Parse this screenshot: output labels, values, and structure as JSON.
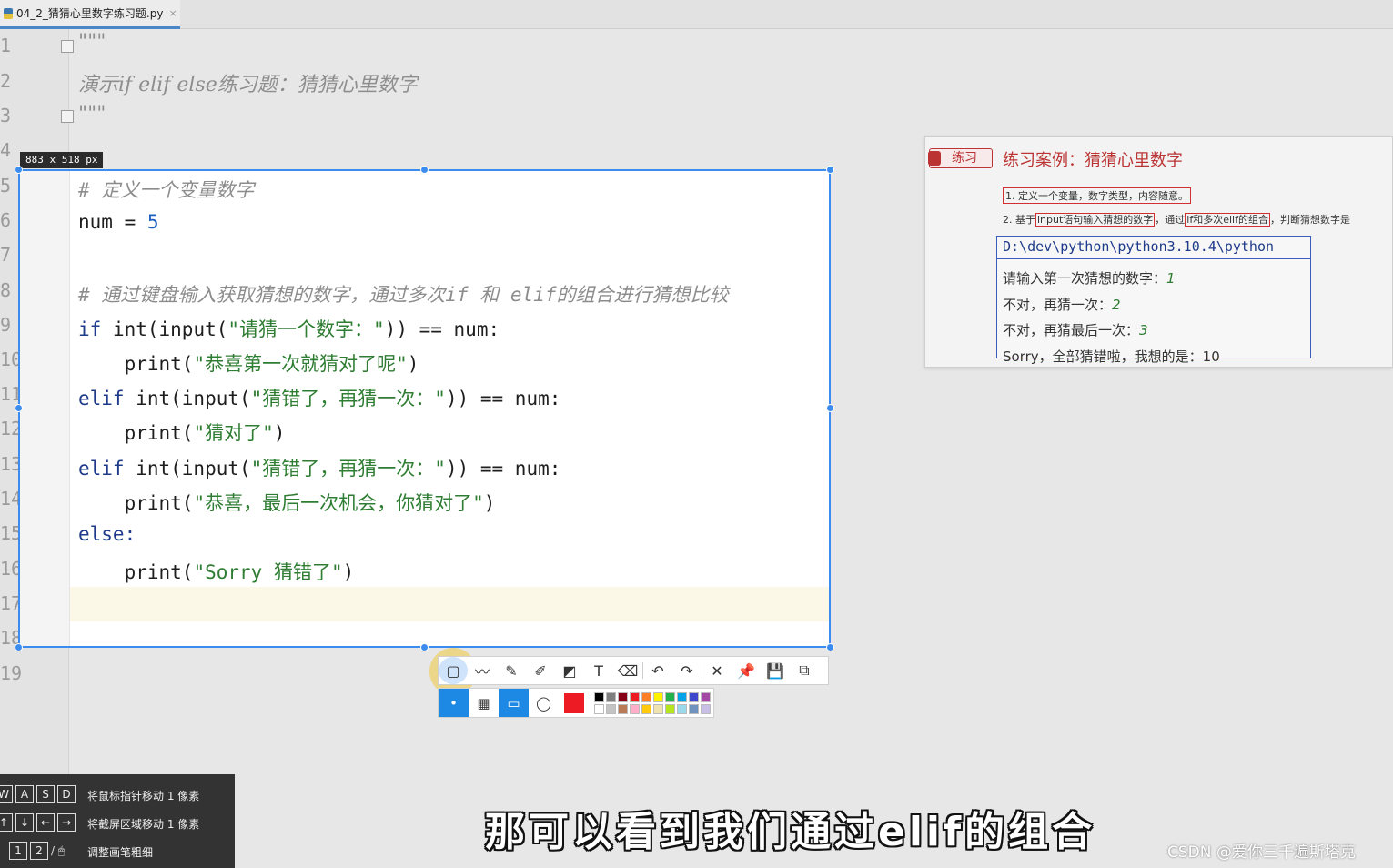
{
  "tab": {
    "filename": "04_2_猜猜心里数字练习题.py",
    "close": "×"
  },
  "gutter": {
    "lines": [
      "1",
      "2",
      "3",
      "4",
      "5",
      "6",
      "7",
      "8",
      "9",
      "10",
      "11",
      "12",
      "13",
      "14",
      "15",
      "16",
      "17",
      "18",
      "19"
    ]
  },
  "editor_bg": {
    "line1": "\"\"\"",
    "line2": "演示if elif else练习题：猜猜心里数字",
    "line3": "\"\"\""
  },
  "selection": {
    "size_label": "883 x 518  px",
    "code": {
      "l5": "# 定义一个变量数字",
      "l6_a": "num = ",
      "l6_b": "5",
      "l8_a": "# 通过键盘输入获取猜想的数字，通过多次",
      "l8_b": "if",
      "l8_c": " 和 ",
      "l8_d": "elif",
      "l8_e": "的组合进行猜想比较",
      "l9_a": "if ",
      "l9_b": "int(input(",
      "l9_c": "\"请猜一个数字：\"",
      "l9_d": ")) == num:",
      "l10_a": "    print(",
      "l10_b": "\"恭喜第一次就猜对了呢\"",
      "l10_c": ")",
      "l11_a": "elif ",
      "l11_b": "int(input(",
      "l11_c": "\"猜错了，再猜一次：\"",
      "l11_d": ")) == num:",
      "l12_a": "    print(",
      "l12_b": "\"猜对了\"",
      "l12_c": ")",
      "l13_a": "elif ",
      "l13_b": "int(input(",
      "l13_c": "\"猜错了，再猜一次：\"",
      "l13_d": ")) == num:",
      "l14_a": "    print(",
      "l14_b": "\"恭喜，最后一次机会，你猜对了\"",
      "l14_c": ")",
      "l15": "else:",
      "l16_a": "    print(",
      "l16_b": "\"Sorry 猜错了\"",
      "l16_c": ")"
    }
  },
  "practice": {
    "tag": "练习",
    "title": "练习案例：猜猜心里数字",
    "point1": "1. 定义一个变量，数字类型，内容随意。",
    "point2_a": "2. 基于",
    "point2_b": "input语句输入猜想的数字",
    "point2_c": "，通过",
    "point2_d": "if和多次elif的组合",
    "point2_e": "，判断猜想数字是",
    "console": {
      "path": "D:\\dev\\python\\python3.10.4\\python",
      "line1_label": "请输入第一次猜想的数字：",
      "line1_value": "1",
      "line2_label": "不对，再猜一次：",
      "line2_value": "2",
      "line3_label": "不对，再猜最后一次：",
      "line3_value": "3",
      "line4": "Sorry，全部猜错啦，我想的是：10"
    }
  },
  "toolbar": {
    "tools": [
      "rect-select-icon",
      "polyline-icon",
      "pencil-icon",
      "marker-icon",
      "mosaic-icon",
      "text-icon",
      "eraser-icon",
      "undo-icon",
      "redo-icon",
      "close-icon",
      "pin-icon",
      "save-icon",
      "copy-icon"
    ],
    "colors_row1": [
      "#000000",
      "#7f7f7f",
      "#880015",
      "#ed1c24",
      "#ff7f27",
      "#fff200",
      "#22b14c",
      "#00a2e8",
      "#3f48cc",
      "#a349a4"
    ],
    "colors_row2": [
      "#ffffff",
      "#c3c3c3",
      "#b97a57",
      "#ffaec9",
      "#ffc90e",
      "#efe4b0",
      "#b5e61d",
      "#99d9ea",
      "#7092be",
      "#c8bfe7"
    ],
    "current_color": "#ed1c24"
  },
  "hotkeys": {
    "row1_keys": [
      "W",
      "A",
      "S",
      "D"
    ],
    "row1_desc": "将鼠标指针移动 1 像素",
    "row2_keys": [
      "↑",
      "↓",
      "←",
      "→"
    ],
    "row2_desc": "将截屏区域移动 1 像素",
    "row3_keys": [
      "1",
      "2"
    ],
    "row3_desc": "调整画笔粗细"
  },
  "subtitle": "那可以看到我们通过elif的组合",
  "watermark": "CSDN @爱你三千遍斯塔克"
}
